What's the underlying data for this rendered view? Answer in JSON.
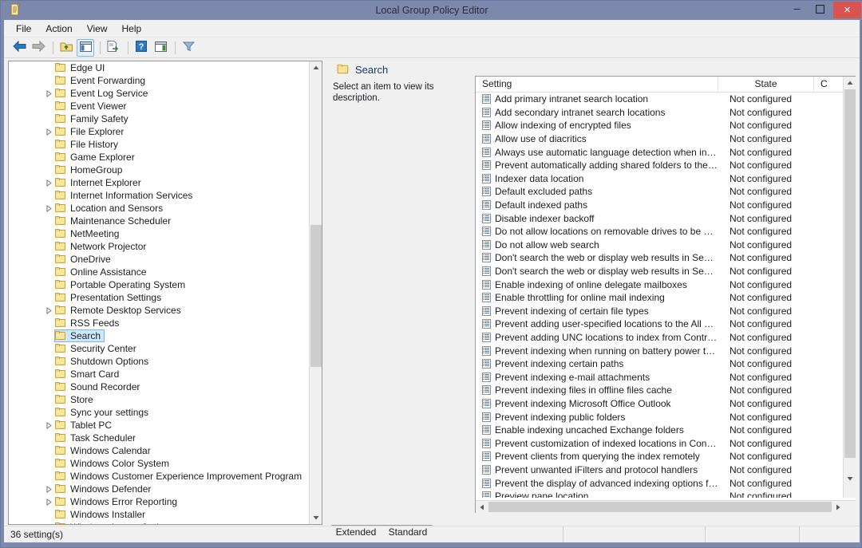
{
  "window": {
    "title": "Local Group Policy Editor",
    "icon": "policy-document-icon",
    "minimize_label": "–",
    "maximize_label": "❑",
    "close_label": "×"
  },
  "menubar": {
    "items": [
      {
        "label": "File"
      },
      {
        "label": "Action"
      },
      {
        "label": "View"
      },
      {
        "label": "Help"
      }
    ]
  },
  "toolbar": {
    "buttons": [
      {
        "name": "back-button",
        "icon": "back-arrow-icon",
        "enabled": true
      },
      {
        "name": "forward-button",
        "icon": "forward-arrow-icon",
        "enabled": false
      },
      {
        "name": "up-one-level-button",
        "icon": "folder-up-icon"
      },
      {
        "name": "show-hide-tree-button",
        "icon": "console-tree-icon",
        "selected": true
      },
      {
        "name": "export-list-button",
        "icon": "export-list-icon"
      },
      {
        "name": "help-button",
        "icon": "help-question-icon"
      },
      {
        "name": "show-action-pane-button",
        "icon": "action-pane-icon"
      },
      {
        "name": "filter-button",
        "icon": "filter-funnel-icon"
      }
    ]
  },
  "tree": {
    "items": [
      {
        "label": "Edge UI",
        "expandable": false
      },
      {
        "label": "Event Forwarding",
        "expandable": false
      },
      {
        "label": "Event Log Service",
        "expandable": true
      },
      {
        "label": "Event Viewer",
        "expandable": false
      },
      {
        "label": "Family Safety",
        "expandable": false
      },
      {
        "label": "File Explorer",
        "expandable": true
      },
      {
        "label": "File History",
        "expandable": false
      },
      {
        "label": "Game Explorer",
        "expandable": false
      },
      {
        "label": "HomeGroup",
        "expandable": false
      },
      {
        "label": "Internet Explorer",
        "expandable": true
      },
      {
        "label": "Internet Information Services",
        "expandable": false
      },
      {
        "label": "Location and Sensors",
        "expandable": true
      },
      {
        "label": "Maintenance Scheduler",
        "expandable": false
      },
      {
        "label": "NetMeeting",
        "expandable": false
      },
      {
        "label": "Network Projector",
        "expandable": false
      },
      {
        "label": "OneDrive",
        "expandable": false
      },
      {
        "label": "Online Assistance",
        "expandable": false
      },
      {
        "label": "Portable Operating System",
        "expandable": false
      },
      {
        "label": "Presentation Settings",
        "expandable": false
      },
      {
        "label": "Remote Desktop Services",
        "expandable": true
      },
      {
        "label": "RSS Feeds",
        "expandable": false
      },
      {
        "label": "Search",
        "expandable": false,
        "selected": true
      },
      {
        "label": "Security Center",
        "expandable": false
      },
      {
        "label": "Shutdown Options",
        "expandable": false
      },
      {
        "label": "Smart Card",
        "expandable": false
      },
      {
        "label": "Sound Recorder",
        "expandable": false
      },
      {
        "label": "Store",
        "expandable": false
      },
      {
        "label": "Sync your settings",
        "expandable": false
      },
      {
        "label": "Tablet PC",
        "expandable": true
      },
      {
        "label": "Task Scheduler",
        "expandable": false
      },
      {
        "label": "Windows Calendar",
        "expandable": false
      },
      {
        "label": "Windows Color System",
        "expandable": false
      },
      {
        "label": "Windows Customer Experience Improvement Program",
        "expandable": false
      },
      {
        "label": "Windows Defender",
        "expandable": true
      },
      {
        "label": "Windows Error Reporting",
        "expandable": true
      },
      {
        "label": "Windows Installer",
        "expandable": false
      },
      {
        "label": "Windows Logon Options",
        "expandable": false
      }
    ]
  },
  "right_pane": {
    "title": "Search",
    "title_icon": "folder-icon",
    "description": "Select an item to view its description.",
    "columns": [
      {
        "key": "setting",
        "label": "Setting"
      },
      {
        "key": "state",
        "label": "State"
      },
      {
        "key": "comment",
        "label": "C"
      }
    ],
    "rows": [
      {
        "setting": "Add primary intranet search location",
        "state": "Not configured"
      },
      {
        "setting": "Add secondary intranet search locations",
        "state": "Not configured"
      },
      {
        "setting": "Allow indexing of encrypted files",
        "state": "Not configured"
      },
      {
        "setting": "Allow use of diacritics",
        "state": "Not configured"
      },
      {
        "setting": "Always use automatic language detection when indexing co...",
        "state": "Not configured"
      },
      {
        "setting": "Prevent automatically adding shared folders to the Window...",
        "state": "Not configured"
      },
      {
        "setting": "Indexer data location",
        "state": "Not configured"
      },
      {
        "setting": "Default excluded paths",
        "state": "Not configured"
      },
      {
        "setting": "Default indexed paths",
        "state": "Not configured"
      },
      {
        "setting": "Disable indexer backoff",
        "state": "Not configured"
      },
      {
        "setting": "Do not allow locations on removable drives to be added to li...",
        "state": "Not configured"
      },
      {
        "setting": "Do not allow web search",
        "state": "Not configured"
      },
      {
        "setting": "Don't search the web or display web results in Search",
        "state": "Not configured"
      },
      {
        "setting": "Don't search the web or display web results in Search over ...",
        "state": "Not configured"
      },
      {
        "setting": "Enable indexing of online delegate mailboxes",
        "state": "Not configured"
      },
      {
        "setting": "Enable throttling for online mail indexing",
        "state": "Not configured"
      },
      {
        "setting": "Prevent indexing of certain file types",
        "state": "Not configured"
      },
      {
        "setting": "Prevent adding user-specified locations to the All Locations ...",
        "state": "Not configured"
      },
      {
        "setting": "Prevent adding UNC locations to index from Control Panel",
        "state": "Not configured"
      },
      {
        "setting": "Prevent indexing when running on battery power to conserv...",
        "state": "Not configured"
      },
      {
        "setting": "Prevent indexing certain paths",
        "state": "Not configured"
      },
      {
        "setting": "Prevent indexing e-mail attachments",
        "state": "Not configured"
      },
      {
        "setting": "Prevent indexing files in offline files cache",
        "state": "Not configured"
      },
      {
        "setting": "Prevent indexing Microsoft Office Outlook",
        "state": "Not configured"
      },
      {
        "setting": "Prevent indexing public folders",
        "state": "Not configured"
      },
      {
        "setting": "Enable indexing uncached Exchange folders",
        "state": "Not configured"
      },
      {
        "setting": "Prevent customization of indexed locations in Control Panel",
        "state": "Not configured"
      },
      {
        "setting": "Prevent clients from querying the index remotely",
        "state": "Not configured"
      },
      {
        "setting": "Prevent unwanted iFilters and protocol handlers",
        "state": "Not configured"
      },
      {
        "setting": "Prevent the display of advanced indexing options for Windo...",
        "state": "Not configured"
      },
      {
        "setting": "Preview pane location",
        "state": "Not configured"
      }
    ]
  },
  "tabs": [
    {
      "label": "Extended",
      "selected": false
    },
    {
      "label": "Standard",
      "selected": true
    }
  ],
  "statusbar": {
    "text": "36 setting(s)"
  },
  "colors": {
    "frame": "#7c88ac",
    "close_button": "#d9534f",
    "selection_fill": "#cce8ff",
    "selection_border": "#7eb4ea",
    "folder_fill": "#fbe3a0",
    "title_link": "#1a3a6b"
  }
}
